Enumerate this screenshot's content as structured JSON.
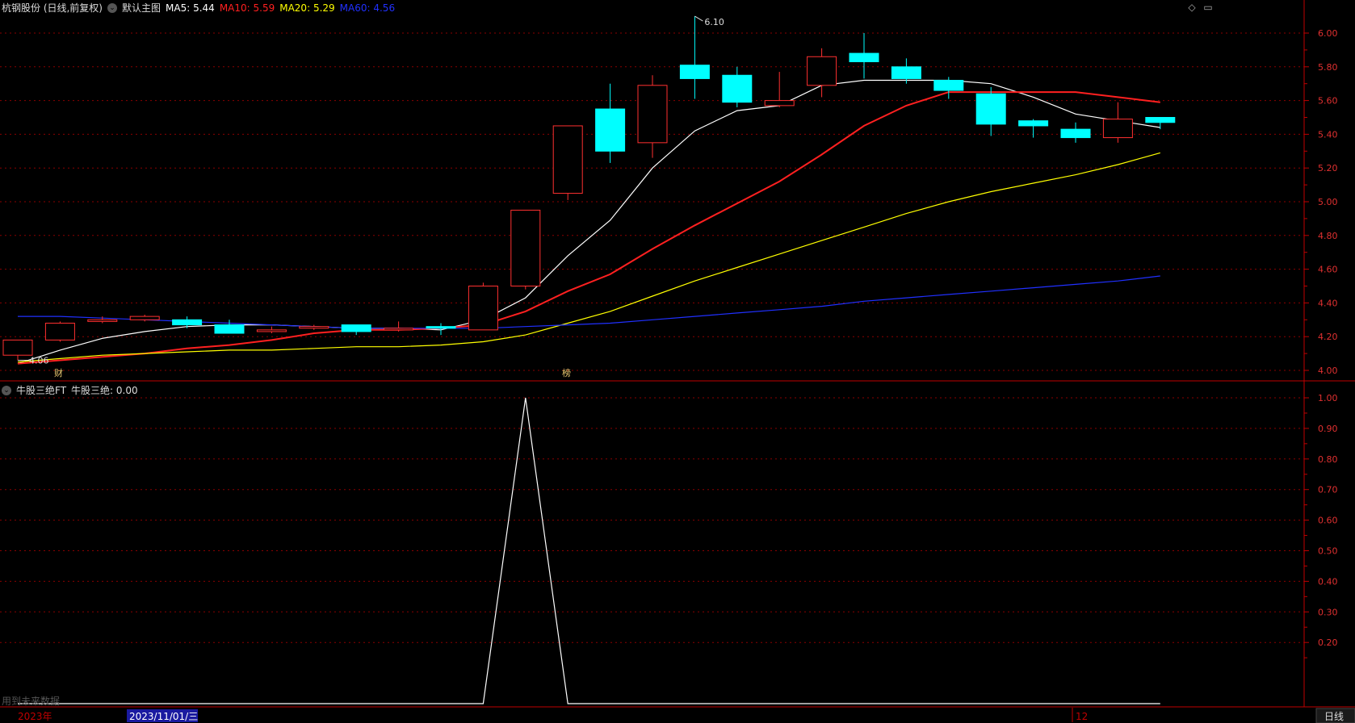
{
  "header": {
    "stock_title": "杭钢股份 (日线,前复权)",
    "main_chart_label": "默认主图",
    "ma5": {
      "label": "MA5:",
      "value": "5.44",
      "color": "#ffffff"
    },
    "ma10": {
      "label": "MA10:",
      "value": "5.59",
      "color": "#ff2020"
    },
    "ma20": {
      "label": "MA20:",
      "value": "5.29",
      "color": "#ffff00"
    },
    "ma60": {
      "label": "MA60:",
      "value": "4.56",
      "color": "#2030ff"
    }
  },
  "corner_icons": [
    "diamond-icon",
    "window-icon"
  ],
  "indicator": {
    "name": "牛股三绝FT",
    "value_label": "牛股三绝:",
    "value": "0.00"
  },
  "markers": {
    "cai": "财",
    "bang": "榜"
  },
  "watermark": "用到未来数据",
  "time_axis": {
    "year": "2023年",
    "cursor_date": "2023/11/01/三",
    "month": "12",
    "period_tab": "日线"
  },
  "colors": {
    "up": "#ff3030",
    "down": "#00ffff",
    "grid": "#8b0000",
    "axis": "#c00000"
  },
  "chart_data": [
    {
      "type": "candlestick",
      "ylim": [
        3.95,
        6.1
      ],
      "yticks": [
        "6.00",
        "5.80",
        "5.60",
        "5.40",
        "5.20",
        "5.00",
        "4.80",
        "4.60",
        "4.40",
        "4.20",
        "4.00"
      ],
      "annotations": {
        "high": "6.10",
        "low": "4.06"
      },
      "candles": [
        {
          "o": 4.09,
          "c": 4.18,
          "h": 4.18,
          "l": 4.06
        },
        {
          "o": 4.18,
          "c": 4.28,
          "h": 4.29,
          "l": 4.17
        },
        {
          "o": 4.29,
          "c": 4.3,
          "h": 4.32,
          "l": 4.28
        },
        {
          "o": 4.3,
          "c": 4.32,
          "h": 4.33,
          "l": 4.29
        },
        {
          "o": 4.3,
          "c": 4.27,
          "h": 4.32,
          "l": 4.25
        },
        {
          "o": 4.27,
          "c": 4.22,
          "h": 4.3,
          "l": 4.22
        },
        {
          "o": 4.23,
          "c": 4.24,
          "h": 4.26,
          "l": 4.22
        },
        {
          "o": 4.25,
          "c": 4.26,
          "h": 4.27,
          "l": 4.24
        },
        {
          "o": 4.27,
          "c": 4.23,
          "h": 4.27,
          "l": 4.21
        },
        {
          "o": 4.24,
          "c": 4.25,
          "h": 4.29,
          "l": 4.23
        },
        {
          "o": 4.26,
          "c": 4.25,
          "h": 4.28,
          "l": 4.21
        },
        {
          "o": 4.24,
          "c": 4.5,
          "h": 4.52,
          "l": 4.24
        },
        {
          "o": 4.5,
          "c": 4.95,
          "h": 4.95,
          "l": 4.48
        },
        {
          "o": 5.05,
          "c": 5.45,
          "h": 5.45,
          "l": 5.01
        },
        {
          "o": 5.55,
          "c": 5.3,
          "h": 5.7,
          "l": 5.23
        },
        {
          "o": 5.35,
          "c": 5.69,
          "h": 5.75,
          "l": 5.26
        },
        {
          "o": 5.81,
          "c": 5.73,
          "h": 6.1,
          "l": 5.61
        },
        {
          "o": 5.75,
          "c": 5.59,
          "h": 5.8,
          "l": 5.56
        },
        {
          "o": 5.57,
          "c": 5.6,
          "h": 5.77,
          "l": 5.56
        },
        {
          "o": 5.69,
          "c": 5.86,
          "h": 5.91,
          "l": 5.62
        },
        {
          "o": 5.88,
          "c": 5.83,
          "h": 6.0,
          "l": 5.73
        },
        {
          "o": 5.8,
          "c": 5.73,
          "h": 5.85,
          "l": 5.7
        },
        {
          "o": 5.72,
          "c": 5.66,
          "h": 5.74,
          "l": 5.61
        },
        {
          "o": 5.64,
          "c": 5.46,
          "h": 5.68,
          "l": 5.39
        },
        {
          "o": 5.48,
          "c": 5.45,
          "h": 5.49,
          "l": 5.38
        },
        {
          "o": 5.43,
          "c": 5.38,
          "h": 5.47,
          "l": 5.35
        },
        {
          "o": 5.38,
          "c": 5.49,
          "h": 5.59,
          "l": 5.35
        },
        {
          "o": 5.5,
          "c": 5.47,
          "h": 5.5,
          "l": 5.43
        }
      ],
      "series": [
        {
          "name": "MA5",
          "color": "#ffffff",
          "values": [
            4.04,
            4.12,
            4.19,
            4.23,
            4.26,
            4.27,
            4.27,
            4.26,
            4.25,
            4.25,
            4.24,
            4.3,
            4.43,
            4.68,
            4.89,
            5.2,
            5.42,
            5.54,
            5.57,
            5.69,
            5.72,
            5.72,
            5.72,
            5.7,
            5.62,
            5.52,
            5.48,
            5.44
          ]
        },
        {
          "name": "MA10",
          "color": "#ff2020",
          "values": [
            4.04,
            4.06,
            4.08,
            4.1,
            4.13,
            4.15,
            4.18,
            4.22,
            4.24,
            4.24,
            4.25,
            4.27,
            4.35,
            4.47,
            4.57,
            4.72,
            4.86,
            4.99,
            5.12,
            5.28,
            5.45,
            5.57,
            5.65,
            5.65,
            5.65,
            5.65,
            5.62,
            5.59
          ]
        },
        {
          "name": "MA20",
          "color": "#ffff00",
          "values": [
            4.05,
            4.07,
            4.09,
            4.1,
            4.11,
            4.12,
            4.12,
            4.13,
            4.14,
            4.14,
            4.15,
            4.17,
            4.21,
            4.28,
            4.35,
            4.44,
            4.53,
            4.61,
            4.69,
            4.77,
            4.85,
            4.93,
            5.0,
            5.06,
            5.11,
            5.16,
            5.22,
            5.29
          ]
        },
        {
          "name": "MA60",
          "color": "#2030ff",
          "values": [
            4.32,
            4.32,
            4.31,
            4.3,
            4.29,
            4.28,
            4.27,
            4.26,
            4.25,
            4.25,
            4.25,
            4.25,
            4.26,
            4.27,
            4.28,
            4.3,
            4.32,
            4.34,
            4.36,
            4.38,
            4.41,
            4.43,
            4.45,
            4.47,
            4.49,
            4.51,
            4.53,
            4.56
          ]
        }
      ]
    },
    {
      "type": "line",
      "ylim": [
        0,
        1.05
      ],
      "yticks": [
        "1.00",
        "0.90",
        "0.80",
        "0.70",
        "0.60",
        "0.50",
        "0.40",
        "0.30",
        "0.20"
      ],
      "series": [
        {
          "name": "牛股三绝",
          "color": "#ffffff",
          "values": [
            0,
            0,
            0,
            0,
            0,
            0,
            0,
            0,
            0,
            0,
            0,
            0,
            1,
            0,
            0,
            0,
            0,
            0,
            0,
            0,
            0,
            0,
            0,
            0,
            0,
            0,
            0,
            0
          ]
        }
      ]
    }
  ]
}
